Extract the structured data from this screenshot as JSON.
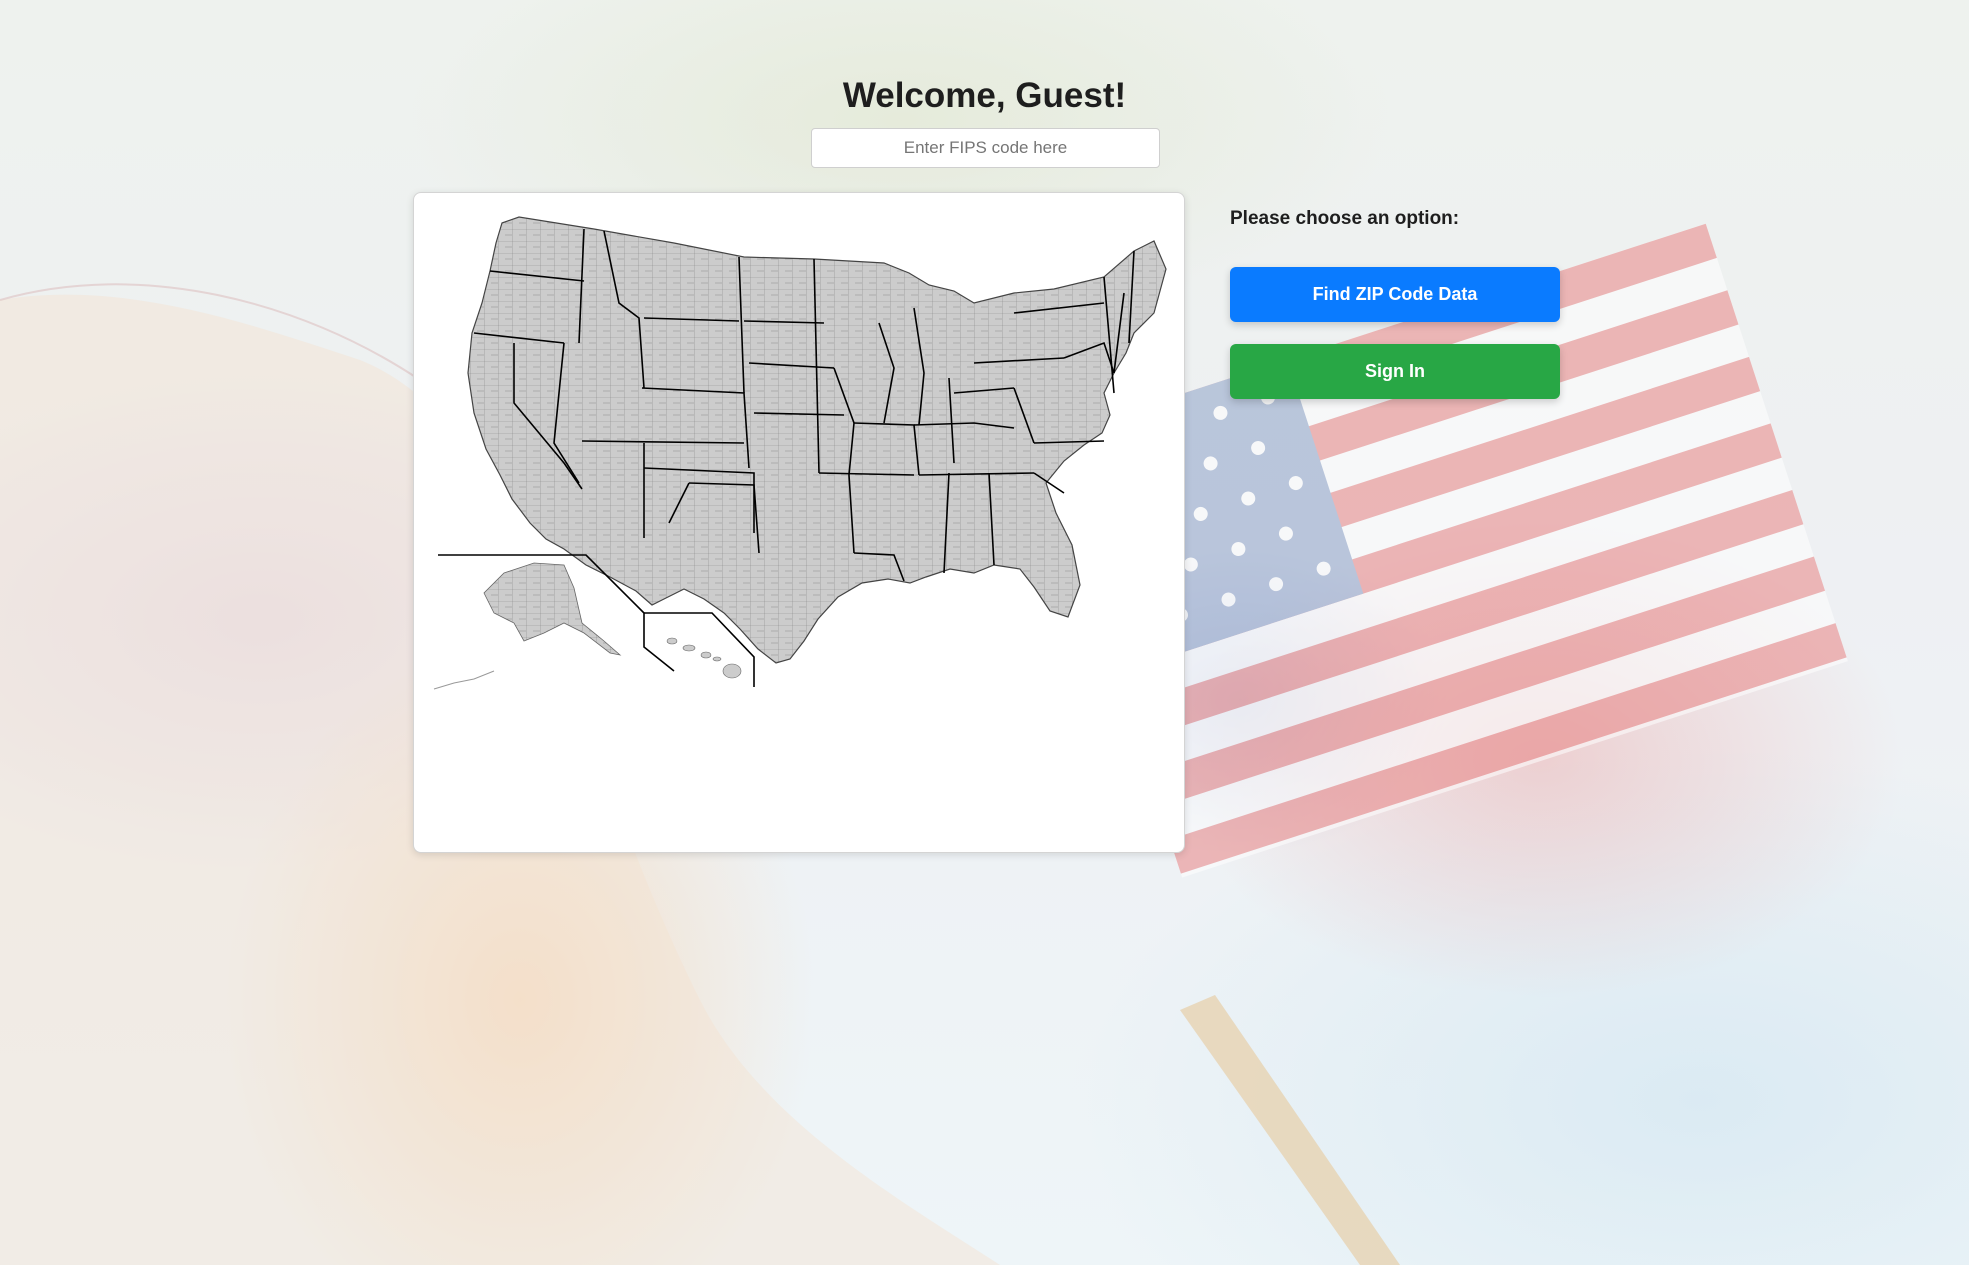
{
  "page": {
    "title": "Welcome, Guest!"
  },
  "fips": {
    "value": "",
    "placeholder": "Enter FIPS code here"
  },
  "map": {
    "fill_color": "#cccccc",
    "county_line_color": "#8a8a8a",
    "state_line_color": "#000000"
  },
  "options": {
    "prompt": "Please choose an option:",
    "find_zip_label": "Find ZIP Code Data",
    "sign_in_label": "Sign In",
    "find_zip_color": "#0a7bff",
    "sign_in_color": "#28a745"
  }
}
